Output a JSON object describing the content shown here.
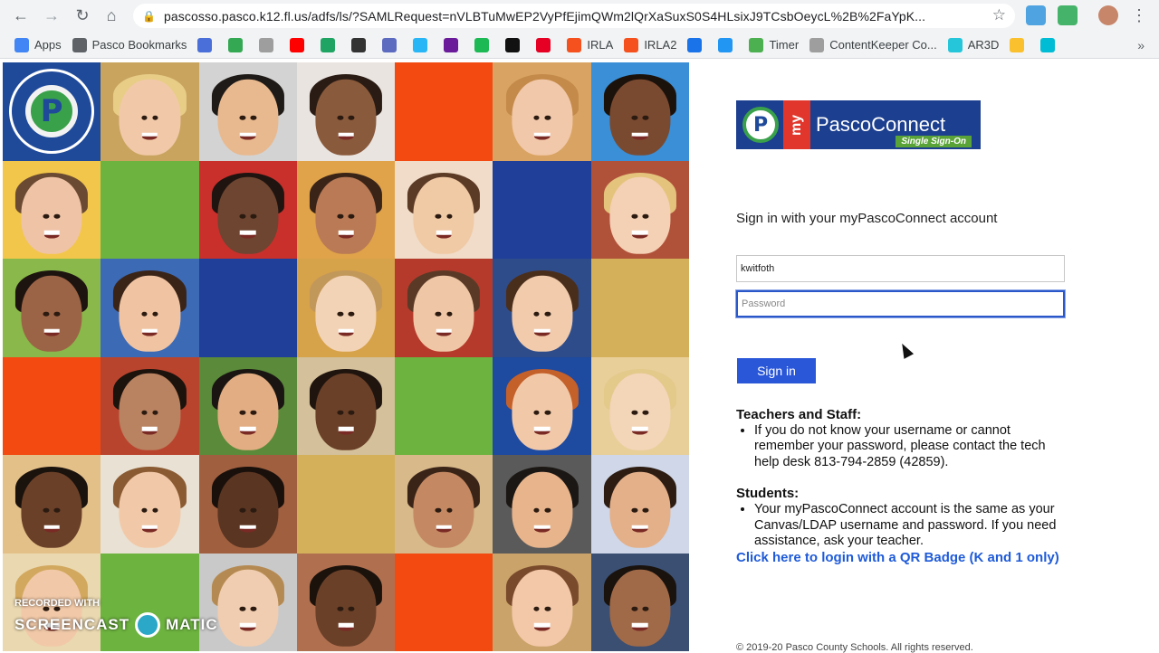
{
  "browser": {
    "url": "pascosso.pasco.k12.fl.us/adfs/ls/?SAMLRequest=nVLBTuMwEP2VyPfEjimQWm2lQrXaSuxS0S4HLsixJ9TCsbOeycL%2B%2FaYpK...",
    "bookmarks": [
      {
        "label": "Apps",
        "color": "#4285f4"
      },
      {
        "label": "Pasco Bookmarks",
        "color": "#5f6368"
      },
      {
        "label": "",
        "color": "#4a6fd8"
      },
      {
        "label": "",
        "color": "#34a853"
      },
      {
        "label": "",
        "color": "#9e9e9e"
      },
      {
        "label": "",
        "color": "#ff0000"
      },
      {
        "label": "",
        "color": "#1fa463"
      },
      {
        "label": "",
        "color": "#333333"
      },
      {
        "label": "",
        "color": "#5c6bc0"
      },
      {
        "label": "",
        "color": "#29b6f6"
      },
      {
        "label": "",
        "color": "#6a1b9a"
      },
      {
        "label": "",
        "color": "#1db954"
      },
      {
        "label": "",
        "color": "#111111"
      },
      {
        "label": "",
        "color": "#e60023"
      },
      {
        "label": "IRLA",
        "color": "#f4511e"
      },
      {
        "label": "IRLA2",
        "color": "#f4511e"
      },
      {
        "label": "",
        "color": "#1a73e8"
      },
      {
        "label": "",
        "color": "#2196f3"
      },
      {
        "label": "Timer",
        "color": "#4caf50"
      },
      {
        "label": "ContentKeeper Co...",
        "color": "#9e9e9e"
      },
      {
        "label": "AR3D",
        "color": "#26c6da"
      },
      {
        "label": "",
        "color": "#fbc02d"
      },
      {
        "label": "",
        "color": "#00bcd4"
      }
    ]
  },
  "login": {
    "brand_name": "PascoConnect",
    "brand_prefix": "my",
    "brand_sub": "Single Sign-On",
    "prompt": "Sign in with your myPascoConnect account",
    "username_value": "kwitfoth",
    "password_placeholder": "Password",
    "submit_label": "Sign in"
  },
  "help": {
    "teachers_heading": "Teachers and Staff:",
    "teachers_text": "If you do not know your username or cannot remember your password, please contact the tech help desk 813-794-2859 (42859).",
    "students_heading": "Students:",
    "students_text": "Your myPascoConnect account is the same as your Canvas/LDAP username and password. If you need assistance, ask your teacher.",
    "qr_link": "Click here to login with a QR Badge (K and 1 only)"
  },
  "footer": "© 2019-20 Pasco County Schools. All rights reserved.",
  "district_logo_text": "PASCO COUNTY SCHOOLS · A WORLD-CLASS EDUCATION",
  "watermark": {
    "small": "RECORDED WITH",
    "left": "SCREENCAST",
    "right": "MATIC"
  },
  "mosaic_tiles": [
    {
      "kind": "logo"
    },
    {
      "kind": "face",
      "bg": "#c8a45f",
      "skin": "#f1c9a8",
      "hair": "#e8cd87"
    },
    {
      "kind": "face",
      "bg": "#d3d3d3",
      "skin": "#e8b98f",
      "hair": "#1e1a17"
    },
    {
      "kind": "face",
      "bg": "#e9e4e0",
      "skin": "#8a5a3c",
      "hair": "#2a1c14"
    },
    {
      "kind": "color",
      "bg": "#f24a10"
    },
    {
      "kind": "face",
      "bg": "#d9a463",
      "skin": "#f2c8aa",
      "hair": "#c48a4a"
    },
    {
      "kind": "face",
      "bg": "#3a8fd6",
      "skin": "#7a4a30",
      "hair": "#1c120c"
    },
    {
      "kind": "face",
      "bg": "#f2c64a",
      "skin": "#efc3a6",
      "hair": "#6a4a32"
    },
    {
      "kind": "color",
      "bg": "#6db33f"
    },
    {
      "kind": "face",
      "bg": "#c9302c",
      "skin": "#6d4530",
      "hair": "#1f1410"
    },
    {
      "kind": "face",
      "bg": "#e0a34a",
      "skin": "#b97a55",
      "hair": "#3a2418"
    },
    {
      "kind": "face",
      "bg": "#f0dcc8",
      "skin": "#f0c9a5",
      "hair": "#5b3a26"
    },
    {
      "kind": "color",
      "bg": "#1f3f99"
    },
    {
      "kind": "face",
      "bg": "#b0523a",
      "skin": "#f4d0b4",
      "hair": "#e4c37c"
    },
    {
      "kind": "face",
      "bg": "#8ab84a",
      "skin": "#9c6446",
      "hair": "#1d1410"
    },
    {
      "kind": "face",
      "bg": "#3c6ab5",
      "skin": "#f0c4a2",
      "hair": "#3a2418"
    },
    {
      "kind": "color",
      "bg": "#1f3f99"
    },
    {
      "kind": "face",
      "bg": "#d6a24a",
      "skin": "#f3d3b6",
      "hair": "#c2975a"
    },
    {
      "kind": "face",
      "bg": "#b53a2c",
      "skin": "#f0c7a6",
      "hair": "#5a3a26"
    },
    {
      "kind": "face",
      "bg": "#2f4c8a",
      "skin": "#f1cbac",
      "hair": "#4a2e1c"
    },
    {
      "kind": "color",
      "bg": "#d4b05a"
    },
    {
      "kind": "color",
      "bg": "#f24a10"
    },
    {
      "kind": "face",
      "bg": "#b9442e",
      "skin": "#b98260",
      "hair": "#1c130d"
    },
    {
      "kind": "face",
      "bg": "#5a8a3a",
      "skin": "#e2ad82",
      "hair": "#1a1512"
    },
    {
      "kind": "face",
      "bg": "#d4c09a",
      "skin": "#6a4028",
      "hair": "#1f140e"
    },
    {
      "kind": "color",
      "bg": "#6db33f"
    },
    {
      "kind": "face",
      "bg": "#1e4aa0",
      "skin": "#f2c9a8",
      "hair": "#c4602a"
    },
    {
      "kind": "face",
      "bg": "#e8cf9a",
      "skin": "#f3d5b8",
      "hair": "#e3c98a"
    },
    {
      "kind": "face",
      "bg": "#e4c089",
      "skin": "#6a4028",
      "hair": "#1a120c"
    },
    {
      "kind": "face",
      "bg": "#e9e1d3",
      "skin": "#f1c9a8",
      "hair": "#8a5a32"
    },
    {
      "kind": "face",
      "bg": "#a06040",
      "skin": "#5a3522",
      "hair": "#1a100b"
    },
    {
      "kind": "color",
      "bg": "#d4b05a"
    },
    {
      "kind": "face",
      "bg": "#d8b98a",
      "skin": "#c48962",
      "hair": "#3a2418"
    },
    {
      "kind": "face",
      "bg": "#5a5a5a",
      "skin": "#e7b48c",
      "hair": "#1b1714"
    },
    {
      "kind": "face",
      "bg": "#cfd7e8",
      "skin": "#e3b08a",
      "hair": "#2c1c12"
    },
    {
      "kind": "face",
      "bg": "#ead8b0",
      "skin": "#f1c9a8",
      "hair": "#d2a85e"
    },
    {
      "kind": "color",
      "bg": "#6db33f"
    },
    {
      "kind": "face",
      "bg": "#c9c9c9",
      "skin": "#f0cdb0",
      "hair": "#b58a52"
    },
    {
      "kind": "face",
      "bg": "#b07050",
      "skin": "#6a4028",
      "hair": "#1c120c"
    },
    {
      "kind": "color",
      "bg": "#f24a10"
    },
    {
      "kind": "face",
      "bg": "#c9a36a",
      "skin": "#f2c8a8",
      "hair": "#7a4a2c"
    },
    {
      "kind": "face",
      "bg": "#3a4f72",
      "skin": "#a06a48",
      "hair": "#1a120d"
    }
  ]
}
